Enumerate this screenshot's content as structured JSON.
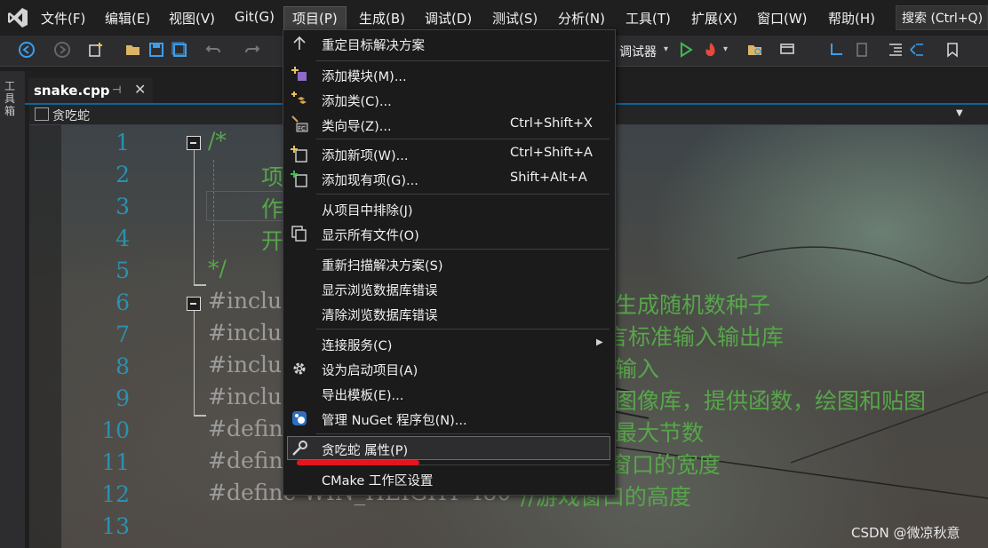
{
  "menubar": {
    "items": [
      "文件(F)",
      "编辑(E)",
      "视图(V)",
      "Git(G)",
      "项目(P)",
      "生成(B)",
      "调试(D)",
      "测试(S)",
      "分析(N)",
      "工具(T)",
      "扩展(X)",
      "窗口(W)",
      "帮助(H)"
    ],
    "search": "搜索 (Ctrl+Q)"
  },
  "toolbar": {
    "debugger_label": "调试器"
  },
  "toolbox": {
    "label": "工具箱"
  },
  "tab": {
    "name": "snake.cpp"
  },
  "navbar": {
    "scope": "贪吃蛇"
  },
  "editor": {
    "line_numbers": [
      "1",
      "2",
      "3",
      "4",
      "5",
      "6",
      "7",
      "8",
      "9",
      "10",
      "11",
      "12",
      "13"
    ],
    "lines": [
      {
        "text": "/*",
        "cls": "cmt"
      },
      {
        "text": "项",
        "cls": "cmt"
      },
      {
        "text": "作",
        "cls": "cmt"
      },
      {
        "text": "开",
        "cls": "cmt"
      },
      {
        "text": "*/",
        "cls": "cmt"
      },
      {
        "text": "#inclu",
        "cls": "pp"
      },
      {
        "text": "#inclu",
        "cls": "pp"
      },
      {
        "text": "#inclu",
        "cls": "pp"
      },
      {
        "text": "#inclu",
        "cls": "pp"
      },
      {
        "text": "#defin",
        "cls": "pp"
      },
      {
        "text": "#defin",
        "cls": "pp"
      },
      {
        "text": "#define WIN_HEIGHT 480",
        "cls": "pp"
      },
      {
        "text": "",
        "cls": "pp"
      }
    ],
    "right_comments": [
      "生成随机数种子",
      "言标准输入输出库",
      "输入",
      "图像库，提供函数，绘图和贴图",
      "最大节数",
      "窗口的宽度",
      "//游戏窗口的高度"
    ]
  },
  "project_menu": {
    "items": [
      {
        "label": "重定目标解决方案",
        "shortcut": "",
        "icon": "arrow-up-icon"
      },
      {
        "label": "添加模块(M)...",
        "shortcut": "",
        "icon": "add-module-icon"
      },
      {
        "label": "添加类(C)...",
        "shortcut": "",
        "icon": "add-class-icon"
      },
      {
        "label": "类向导(Z)...",
        "shortcut": "Ctrl+Shift+X",
        "icon": "class-wizard-icon"
      },
      {
        "label": "添加新项(W)...",
        "shortcut": "Ctrl+Shift+A",
        "icon": "add-new-item-icon"
      },
      {
        "label": "添加现有项(G)...",
        "shortcut": "Shift+Alt+A",
        "icon": "add-existing-item-icon"
      },
      {
        "label": "从项目中排除(J)",
        "shortcut": "",
        "icon": ""
      },
      {
        "label": "显示所有文件(O)",
        "shortcut": "",
        "icon": "show-all-files-icon"
      },
      {
        "label": "重新扫描解决方案(S)",
        "shortcut": "",
        "icon": ""
      },
      {
        "label": "显示浏览数据库错误",
        "shortcut": "",
        "icon": ""
      },
      {
        "label": "清除浏览数据库错误",
        "shortcut": "",
        "icon": ""
      },
      {
        "label": "连接服务(C)",
        "shortcut": "",
        "icon": ""
      },
      {
        "label": "设为启动项目(A)",
        "shortcut": "",
        "icon": "gear-icon"
      },
      {
        "label": "导出模板(E)...",
        "shortcut": "",
        "icon": ""
      },
      {
        "label": "管理 NuGet 程序包(N)...",
        "shortcut": "",
        "icon": "nuget-icon"
      },
      {
        "label": "贪吃蛇 属性(P)",
        "shortcut": "",
        "icon": "wrench-icon"
      },
      {
        "label": "CMake 工作区设置",
        "shortcut": "",
        "icon": ""
      }
    ],
    "highlighted": "贪吃蛇 属性(P)"
  },
  "watermark": "CSDN @微凉秋意",
  "colors": {
    "accent": "#0e639c",
    "comment": "#57a64a",
    "line_number": "#2b91af",
    "annotation": "#e5151e"
  }
}
